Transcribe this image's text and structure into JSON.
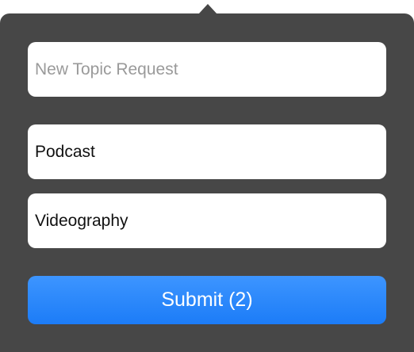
{
  "form": {
    "new_topic_placeholder": "New Topic Request",
    "topics": [
      "Podcast",
      "Videography"
    ],
    "submit_label": "Submit (2)"
  },
  "colors": {
    "panel_background": "#474747",
    "field_background": "#ffffff",
    "submit_button": "#1e82fb",
    "placeholder_text": "#9a9a9a"
  }
}
